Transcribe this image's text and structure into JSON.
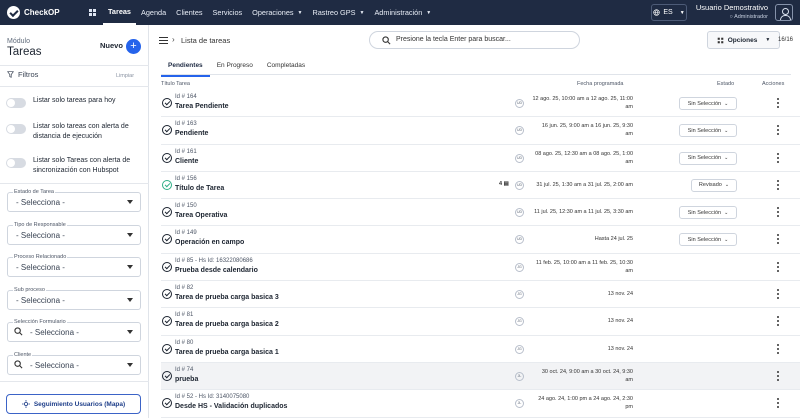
{
  "app": {
    "name": "CheckOP"
  },
  "nav": {
    "items": [
      {
        "label": "Tareas",
        "active": true,
        "dropdown": false
      },
      {
        "label": "Agenda",
        "active": false,
        "dropdown": false
      },
      {
        "label": "Clientes",
        "active": false,
        "dropdown": false
      },
      {
        "label": "Servicios",
        "active": false,
        "dropdown": false
      },
      {
        "label": "Operaciones",
        "active": false,
        "dropdown": true
      },
      {
        "label": "Rastreo GPS",
        "active": false,
        "dropdown": true
      },
      {
        "label": "Administración",
        "active": false,
        "dropdown": true
      }
    ]
  },
  "language": "ES",
  "user": {
    "name": "Usuario Demostrativo",
    "role": "Administrador"
  },
  "sidebar": {
    "module_label": "Módulo",
    "module_title": "Tareas",
    "new_label": "Nuevo",
    "filters_label": "Filtros",
    "clear_label": "Limpiar",
    "toggles": [
      {
        "label": "Listar solo tareas para hoy"
      },
      {
        "label": "Listar solo tareas con alerta de distancia de ejecución"
      },
      {
        "label": "Listar solo Tareas con alerta de sincronización con Hubspot"
      }
    ],
    "fields": [
      {
        "label": "Estado de Tarea",
        "value": "- Selecciona -",
        "icon": false
      },
      {
        "label": "Tipo de Responsable",
        "value": "- Selecciona -",
        "icon": false
      },
      {
        "label": "Proceso Relacionado",
        "value": "- Selecciona -",
        "icon": false
      },
      {
        "label": "Sub proceso",
        "value": "- Selecciona -",
        "icon": false
      },
      {
        "label": "Selección Formulario",
        "value": "- Selecciona -",
        "icon": true
      },
      {
        "label": "Cliente",
        "value": "- Selecciona -",
        "icon": true
      }
    ],
    "map_button": "Seguimiento Usuarios (Mapa)"
  },
  "main": {
    "title": "Lista de tareas",
    "search_placeholder": "Presione la tecla Enter para buscar...",
    "options_label": "Opciones",
    "count": "16/16",
    "tabs": [
      {
        "label": "Pendientes",
        "active": true
      },
      {
        "label": "En Progreso",
        "active": false
      },
      {
        "label": "Completadas",
        "active": false
      }
    ],
    "columns": {
      "title": "Título Tarea",
      "date": "Fecha programada",
      "status": "Estado",
      "actions": "Acciones"
    }
  },
  "tasks": [
    {
      "id": "Id # 164",
      "name": "Tarea Pendiente",
      "avatar": "UD",
      "date": [
        "12 ago. 25, 10:00 am a 12 ago. 25, 11:00",
        "am"
      ],
      "status": "Sin Selección",
      "done": false,
      "highlight": false,
      "msg": ""
    },
    {
      "id": "Id # 163",
      "name": "Pendiente",
      "avatar": "UD",
      "date": [
        "16 jun. 25, 9:00 am a 16 jun. 25, 9:30",
        "am"
      ],
      "status": "Sin Selección",
      "done": false,
      "highlight": false,
      "msg": ""
    },
    {
      "id": "Id # 161",
      "name": "Cliente",
      "avatar": "UD",
      "date": [
        "08 ago. 25, 12:30 am a 08 ago. 25, 1:00",
        "am"
      ],
      "status": "Sin Selección",
      "done": false,
      "highlight": false,
      "msg": ""
    },
    {
      "id": "Id # 156",
      "name": "Título de Tarea",
      "avatar": "UD",
      "date": [
        "31 jul. 25, 1:30 am a 31 jul. 25, 2:00 am"
      ],
      "status": "Revisado",
      "done": true,
      "highlight": false,
      "msg": "4"
    },
    {
      "id": "Id # 150",
      "name": "Tarea Operativa",
      "avatar": "UD",
      "date": [
        "11 jul. 25, 12:30 am a 11 jul. 25, 3:30 am"
      ],
      "status": "Sin Selección",
      "done": false,
      "highlight": false,
      "msg": ""
    },
    {
      "id": "Id # 149",
      "name": "Operación en campo",
      "avatar": "UD",
      "date": [
        "Hasta 24 jul. 25"
      ],
      "status": "Sin Selección",
      "done": false,
      "highlight": false,
      "msg": ""
    },
    {
      "id": "Id # 85 - Hs Id: 16322080686",
      "name": "Prueba desde calendario",
      "avatar": "JG",
      "date": [
        "11 feb. 25, 10:00 am a 11 feb. 25, 10:30",
        "am"
      ],
      "status": "",
      "done": false,
      "highlight": false,
      "msg": ""
    },
    {
      "id": "Id # 82",
      "name": "Tarea de prueba carga basica 3",
      "avatar": "JG",
      "date": [
        "13 nov. 24"
      ],
      "status": "",
      "done": false,
      "highlight": false,
      "msg": ""
    },
    {
      "id": "Id # 81",
      "name": "Tarea de prueba carga basica 2",
      "avatar": "JG",
      "date": [
        "13 nov. 24"
      ],
      "status": "",
      "done": false,
      "highlight": false,
      "msg": ""
    },
    {
      "id": "Id # 80",
      "name": "Tarea de prueba carga basica 1",
      "avatar": "JG",
      "date": [
        "13 nov. 24"
      ],
      "status": "",
      "done": false,
      "highlight": false,
      "msg": ""
    },
    {
      "id": "Id # 74",
      "name": "prueba",
      "avatar": "JL",
      "date": [
        "30 oct. 24, 9:00 am a 30 oct. 24, 9:30",
        "am"
      ],
      "status": "",
      "done": false,
      "highlight": true,
      "msg": ""
    },
    {
      "id": "Id # 52 - Hs Id: 3140075080",
      "name": "Desde HS - Validación duplicados",
      "avatar": "JL",
      "date": [
        "24 ago. 24, 1:00 pm a 24 ago. 24, 2:30",
        "pm"
      ],
      "status": "",
      "done": false,
      "highlight": false,
      "msg": ""
    }
  ]
}
